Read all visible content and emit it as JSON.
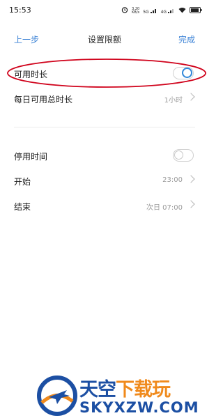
{
  "status": {
    "time": "15:53",
    "net_speed_top": "3.20",
    "net_speed_bottom": "KB/s",
    "sim1": "5G",
    "sim2": "4G"
  },
  "nav": {
    "back_label": "上一步",
    "title": "设置限额",
    "done_label": "完成"
  },
  "settings": {
    "available_time": {
      "label": "可用时长",
      "enabled": true
    },
    "daily_total": {
      "label": "每日可用总时长",
      "value": "1小时"
    },
    "downtime": {
      "label": "停用时间",
      "enabled": false
    },
    "start": {
      "label": "开始",
      "value": "23:00"
    },
    "end": {
      "label": "结束",
      "value": "次日 07:00"
    }
  },
  "colors": {
    "accent": "#3b82d6",
    "highlight": "#d0021b"
  },
  "watermark": {
    "cn_part1": "天空",
    "cn_part2": "下载玩",
    "en": "SKYXZW.COM"
  }
}
